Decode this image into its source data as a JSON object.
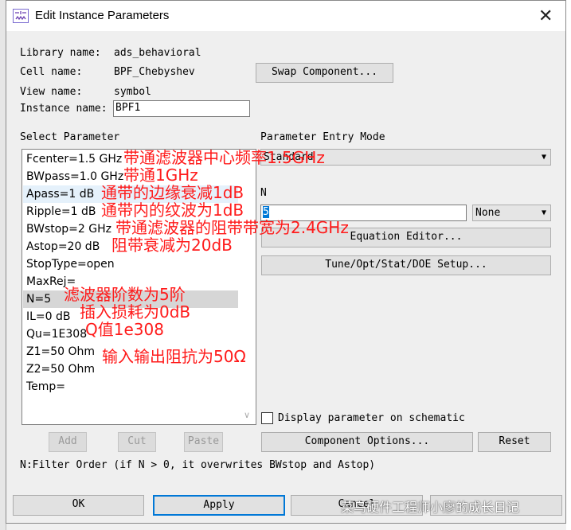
{
  "window": {
    "title": "Edit Instance Parameters"
  },
  "info": {
    "library_label": "Library name:",
    "library_value": "ads_behavioral",
    "cell_label": "Cell name:",
    "cell_value": "BPF_Chebyshev",
    "view_label": "View name:",
    "view_value": "symbol",
    "instance_label": "Instance name:",
    "instance_value": "BPF1",
    "swap_button": "Swap Component..."
  },
  "params": {
    "heading": "Select Parameter",
    "items": [
      "Fcenter=1.5 GHz",
      "BWpass=1.0 GHz",
      "Apass=1 dB",
      "Ripple=1 dB",
      "BWstop=2 GHz",
      "Astop=20 dB",
      "StopType=open",
      "MaxRej=",
      "N=5",
      "IL=0 dB",
      "Qu=1E308",
      "Z1=50 Ohm",
      "Z2=50 Ohm",
      "Temp="
    ],
    "selected": "N=5",
    "add": "Add",
    "cut": "Cut",
    "paste": "Paste"
  },
  "entry": {
    "heading": "Parameter Entry Mode",
    "mode": "Standard",
    "param_label": "N",
    "value": "5",
    "unit": "None",
    "equation_editor": "Equation Editor...",
    "tune": "Tune/Opt/Stat/DOE Setup...",
    "display_checkbox": "Display parameter on schematic",
    "display_checked": false,
    "component_options": "Component Options...",
    "reset": "Reset"
  },
  "hint": "N:Filter Order (if N > 0, it overwrites BWstop and Astop)",
  "footer": {
    "ok": "OK",
    "apply": "Apply",
    "cancel": "Cancel"
  },
  "annotations": [
    "带通滤波器中心频率1.5GHz",
    "带通1GHz",
    "通带的边缘衰减1dB",
    "通带内的纹波为1dB",
    "带通滤波器的阻带带宽为2.4GHz",
    "阻带衰减为20dB",
    "滤波器阶数为5阶",
    "插入损耗为0dB",
    "Q值1e308",
    "输入输出阻抗为50Ω"
  ],
  "watermark": "菜鸟硬件工程师小廖的成长日记",
  "colors": {
    "annotation": "#ff1a1a",
    "focus": "#0078d7"
  }
}
